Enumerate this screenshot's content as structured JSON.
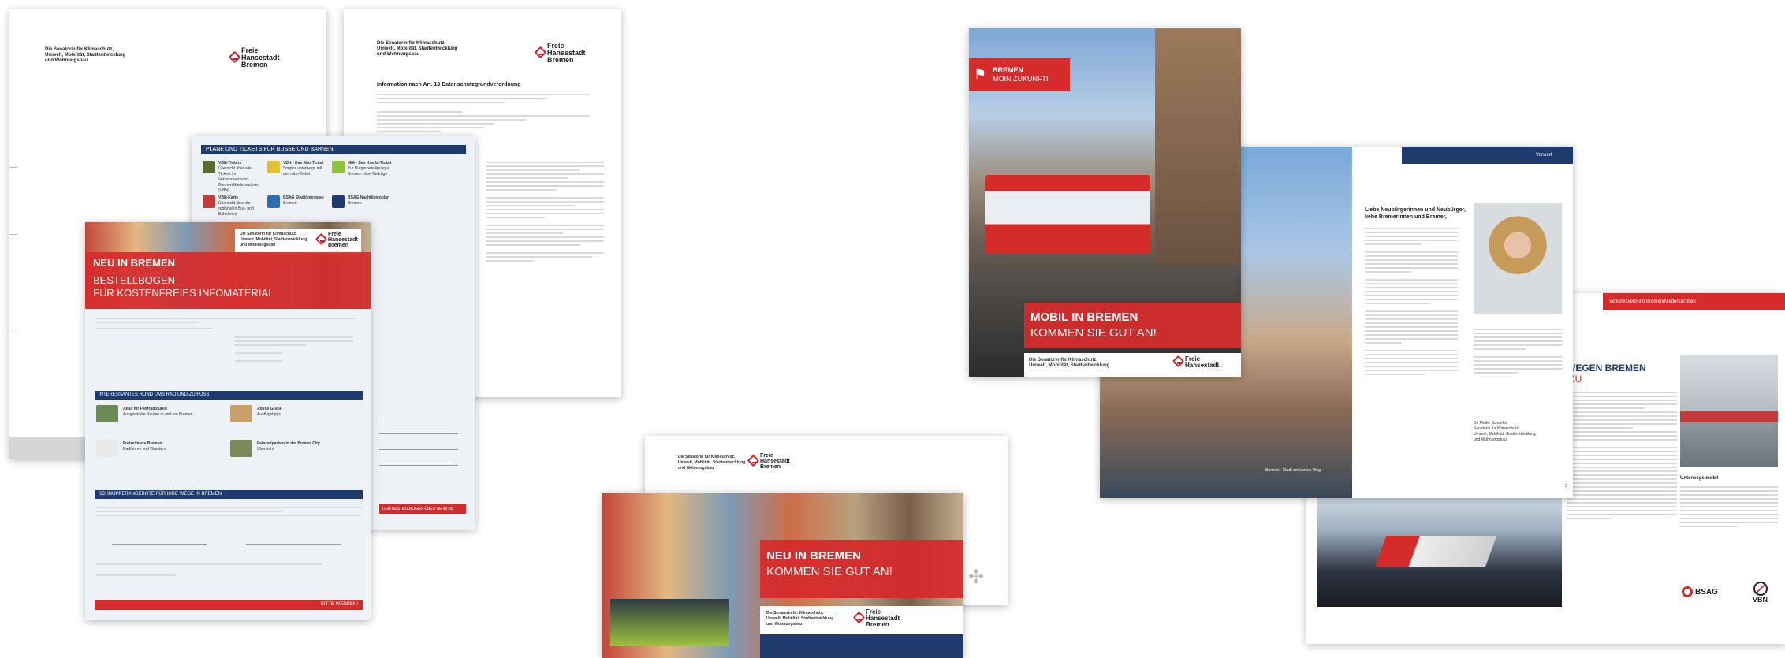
{
  "pages": {
    "doc1": {
      "sender_line1": "Die Senatorin für Klimaschutz,",
      "sender_line2": "Umwelt, Mobilität, Stadtentwicklung",
      "sender_line3": "und Wohnungsbau",
      "logo_text": "Freie\nHansestadt\nBremen"
    },
    "doc2": {
      "sender": "Die Senatorin für Klimaschutz,\nUmwelt, Mobilität, Stadtentwicklung\nund Wohnungsbau",
      "logo_text": "Freie\nHansestadt\nBremen",
      "heading": "Information nach Art. 13 Datenschutzgrundverordnung"
    },
    "plan_sheet": {
      "header": "PLANE UND TICKETS FÜR BUSSE UND BAHNEN",
      "items": [
        {
          "title": "VBN-Tickets",
          "desc": "Übersicht über alle Tickets im Verkehrsverbund Bremen/Niedersachsen (VBN)"
        },
        {
          "title": "VBN - Das Abo-Ticket",
          "desc": "Sorglos unterwegs mit dem Abo-Ticket"
        },
        {
          "title": "MIA - Das Kombi-Ticket",
          "desc": "Zur Bürgerbeteiligung in Bremen ohne Beiträge"
        },
        {
          "title": "VBN-Karte",
          "desc": "Übersicht über die regionalen Bus- und Bahnlinien"
        },
        {
          "title": "BSAG Stadtlinienplan",
          "desc": "Bremen"
        },
        {
          "title": "BSAG Nachtlinienplan",
          "desc": "Bremen"
        }
      ]
    },
    "order_form": {
      "logo_text": "Freie\nHansestadt\nBremen",
      "sender": "Die Senatorin für Klimaschutz,\nUmwelt, Mobilität, Stadtentwicklung\nund Wohnungsbau",
      "kicker": "NEU IN BREMEN",
      "title_line1": "BESTELLBOGEN",
      "title_line2": "FÜR KOSTENFREIES INFOMATERIAL",
      "section1": "INTERESSANTES RUND UMS RAD UND ZU FUSS",
      "items": [
        {
          "title": "Atlas für Fahrradtouren",
          "desc": "Ausgewählte Routen in und um Bremen"
        },
        {
          "title": "Ab ins Grüne",
          "desc": "Ausflugstipps"
        },
        {
          "title": "Freizeitkarte Bremen",
          "desc": "Radfahren und Wandern"
        },
        {
          "title": "Fahrradparken in der Bremer City",
          "desc": "Übersicht"
        }
      ],
      "section2": "SCHNUPPERANGEBOTE FÜR IHRE WEGE IN BREMEN",
      "footer": "BITTE WENDEN!",
      "spare_tab": "DEN BESTELLBOGEN ÜBER BE IM AB"
    },
    "flyer": {
      "sender": "Die Senatorin für Klimaschutz,\nUmwelt, Mobilität, Stadtentwicklung\nund Wohnungsbau",
      "logo_text": "Freie\nHansestadt\nBremen",
      "kicker": "NEU IN BREMEN",
      "title": "KOMMEN SIE GUT AN!"
    },
    "brochure_cover": {
      "brand_line1": "BREMEN",
      "brand_line2": "MOIN ZUKUNFT!",
      "kicker": "MOBIL IN BREMEN",
      "title": "KOMMEN SIE GUT AN!",
      "sender": "Die Senatorin für Klimaschutz,\nUmwelt, Mobilität, Stadtentwicklung",
      "logo_text": "Freie\nHansestadt"
    },
    "brochure_spread": {
      "tab": "Vorwort",
      "greeting": "Liebe Neubürgerinnen und Neubürger,\nliebe Bremerinnen und Bremer,",
      "caption": "Bremen - Stadt am kurzen Weg",
      "signoff_name": "Dr. Maike Schaefer",
      "signoff_role": "Senatorin für Klimaschutz,\nUmwelt, Mobilität, Stadtentwicklung\nund Wohnungsbau",
      "page_no": "3"
    },
    "brochure_right": {
      "tab": "Verkehrsverbund Bremen/Niedersachsen",
      "heading_line1": "WEGEN BREMEN",
      "heading_line2": "IZU",
      "sub": "Unterwegs mobil",
      "logo_bsag": "BSAG",
      "logo_vbn": "VBN"
    }
  },
  "colors": {
    "accent_red": "#d52b2b",
    "navy": "#1f3b6e",
    "paper": "#ffffff"
  },
  "icons": [
    "key-logo-icon",
    "windmill-icon",
    "signpost-icon"
  ]
}
